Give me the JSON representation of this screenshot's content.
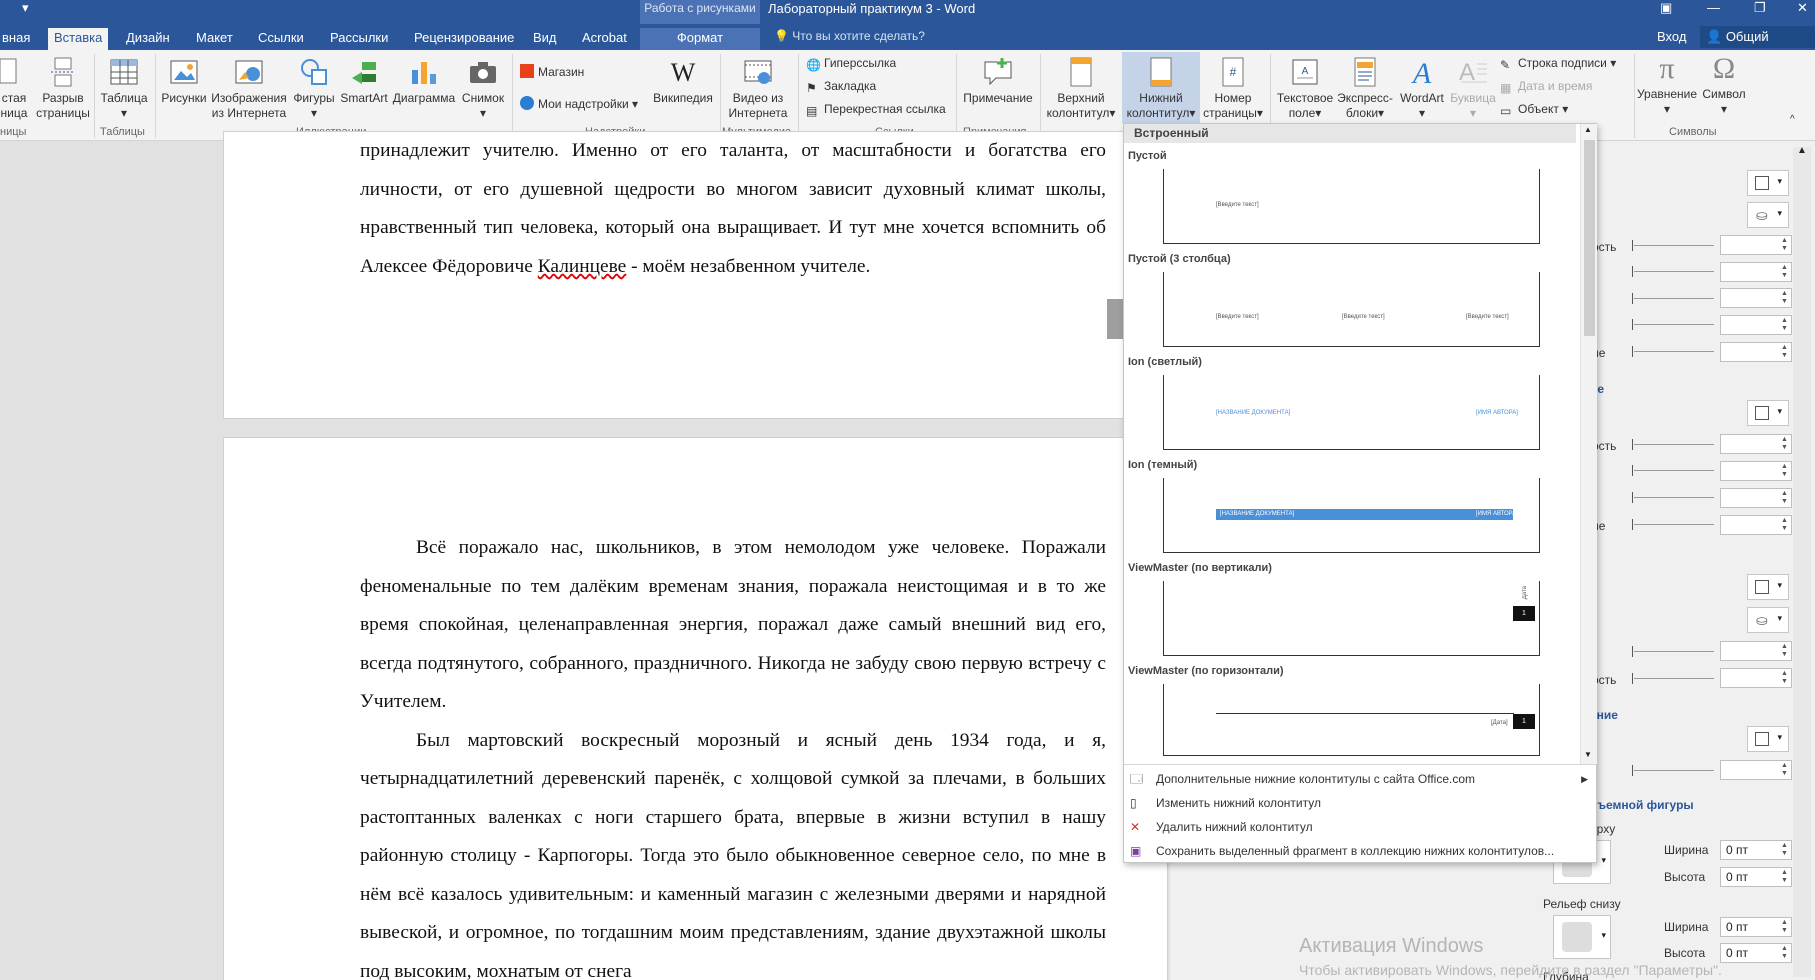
{
  "window": {
    "title": "Лабораторный практикум 3 - Word",
    "context_tab": "Работа с рисунками"
  },
  "tabs": [
    "вная",
    "Вставка",
    "Дизайн",
    "Макет",
    "Ссылки",
    "Рассылки",
    "Рецензирование",
    "Вид",
    "Acrobat",
    "Формат"
  ],
  "tell_me": "Что вы хотите сделать?",
  "login": "Вход",
  "share": "Общий доступ",
  "ribbon": {
    "pages": {
      "blank": "стая",
      "blank2": "ница",
      "break": "Разрыв",
      "break2": "страницы"
    },
    "table": "Таблица",
    "pictures": "Рисунки",
    "online_pictures": "Изображения",
    "online_pictures2": "из Интернета",
    "shapes": "Фигуры",
    "smartart": "SmartArt",
    "chart": "Диаграмма",
    "screenshot": "Снимок",
    "store": "Магазин",
    "my_addins": "Мои надстройки",
    "wikipedia": "Википедия",
    "video": "Видео из",
    "video2": "Интернета",
    "hyperlink": "Гиперссылка",
    "bookmark": "Закладка",
    "crossref": "Перекрестная ссылка",
    "comment": "Примечание",
    "header": "Верхний",
    "header2": "колонтитул",
    "footer": "Нижний",
    "footer2": "колонтитул",
    "pagenum": "Номер",
    "pagenum2": "страницы",
    "textbox": "Текстовое",
    "textbox2": "поле",
    "quickparts": "Экспресс-",
    "quickparts2": "блоки",
    "wordart": "WordArt",
    "dropcap": "Буквица",
    "signature": "Строка подписи",
    "datetime": "Дата и время",
    "object": "Объект",
    "equation": "Уравнение",
    "symbol": "Символ",
    "groups": {
      "pages": "ницы",
      "tables": "Таблицы",
      "illustrations": "Иллюстрации",
      "addins": "Надстройки",
      "media": "Мультимедиа",
      "links": "Ссылки",
      "comments": "Примечания",
      "symbols": "Символы"
    }
  },
  "document": {
    "page1_lines": "принадлежит учителю. Именно от его таланта, от масштабности и богатства его личности, от его душевной щедрости во многом зависит духовный климат школы, нравственный тип человека, который она выращивает. И тут мне хочется вспомнить об Алексее Фёдоровиче ",
    "page1_name": "Калинцеве",
    "page1_end": " - моём незабвенном учителе.",
    "para1": "Всё поражало нас, школьников, в этом немолодом уже человеке. Поражали феноменальные по тем далёким временам знания, поражала неистощимая и в то же время спокойная, целенаправленная энергия, поражал даже самый внешний вид его, всегда подтянутого, собранного, праздничного. Никогда не забуду свою первую встречу с Учителем.",
    "para2": "Был мартовский воскресный морозный и ясный день 1934 года, и я, четырнадцатилетний деревенский паренёк, с холщовой сумкой за плечами, в больших растоптанных валенках с ноги старшего брата, впервые в жизни вступил в нашу районную столицу - Карпогоры. Тогда это было обыкновенное северное село, по мне в нём всё казалось удивительным: и каменный магазин с железными дверями и нарядной вывеской, и огромное, по тогдашним моим представлениям, здание двухэтажной школы под высоким, мохнатым от снега"
  },
  "gallery": {
    "header": "Встроенный",
    "items": [
      {
        "name": "Пустой",
        "texts": [
          "[Введите текст]"
        ]
      },
      {
        "name": "Пустой (3 столбца)",
        "texts": [
          "[Введите текст]",
          "[Введите текст]",
          "[Введите текст]"
        ]
      },
      {
        "name": "Ion (светлый)",
        "texts": [
          "[НАЗВАНИЕ ДОКУМЕНТА]",
          "[ИМЯ АВТОРА]"
        ]
      },
      {
        "name": "Ion (темный)",
        "texts": [
          "[НАЗВАНИЕ ДОКУМЕНТА]",
          "[ИМЯ АВТОРА]"
        ]
      },
      {
        "name": "ViewMaster (по вертикали)",
        "texts": [
          "Дата",
          "1"
        ]
      },
      {
        "name": "ViewMaster (по горизонтали)",
        "texts": [
          "[Дата]",
          "1"
        ]
      }
    ],
    "menu": [
      "Дополнительные нижние колонтитулы с сайта Office.com",
      "Изменить нижний колонтитул",
      "Удалить нижний колонтитул",
      "Сохранить выделенный фрагмент в коллекцию нижних колонтитулов..."
    ]
  },
  "pane": {
    "labels": [
      "ость",
      "ие",
      "ость",
      "ие",
      "ость"
    ],
    "headers": [
      "ие",
      "е",
      "ание",
      "бъемной фигуры"
    ],
    "relief_top": "ерху",
    "relief_bottom": "Рельеф снизу",
    "depth": "Глубина",
    "width": "Ширина",
    "height": "Высота",
    "zero": "0 пт"
  },
  "activation": {
    "title": "Активация Windows",
    "sub": "Чтобы активировать Windows, перейдите в раздел \"Параметры\"."
  },
  "colors": {
    "brand": "#2b579a",
    "context": "#4a72b4",
    "accent_blue": "#4a90d9"
  }
}
